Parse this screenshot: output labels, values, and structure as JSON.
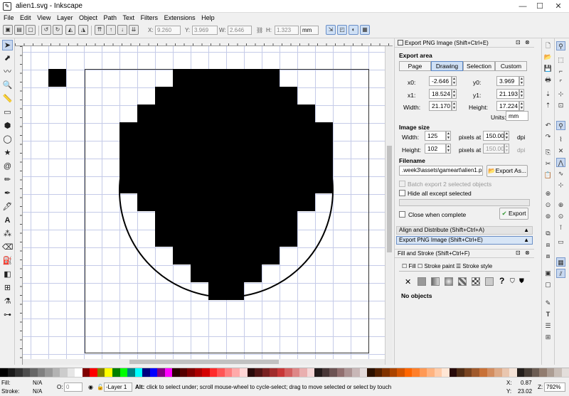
{
  "window": {
    "title": "alien1.svg - Inkscape"
  },
  "menu": [
    "File",
    "Edit",
    "View",
    "Layer",
    "Object",
    "Path",
    "Text",
    "Filters",
    "Extensions",
    "Help"
  ],
  "toolbar": {
    "x_label": "X:",
    "x_value": "9.260",
    "y_label": "Y:",
    "y_value": "3.969",
    "w_label": "W:",
    "w_value": "2.646",
    "h_label": "H:",
    "h_value": "1.323",
    "unit": "mm"
  },
  "export": {
    "panel_title": "Export PNG Image (Shift+Ctrl+E)",
    "area_heading": "Export area",
    "tabs": [
      "Page",
      "Drawing",
      "Selection",
      "Custom"
    ],
    "active_tab": "Drawing",
    "x0_label": "x0:",
    "x0": "-2.646",
    "y0_label": "y0:",
    "y0": "3.969",
    "x1_label": "x1:",
    "x1": "18.524",
    "y1_label": "y1:",
    "y1": "21.193",
    "width_label": "Width:",
    "width": "21.170",
    "height_label": "Height:",
    "height": "17.224",
    "units_label": "Units:",
    "units": "mm",
    "size_heading": "Image size",
    "img_width_label": "Width:",
    "img_width": "125",
    "img_height_label": "Height:",
    "img_height": "102",
    "pixels_at": "pixels at",
    "dpi_x": "150.00",
    "dpi_y": "150.00",
    "dpi": "dpi",
    "filename_heading": "Filename",
    "filename": ".week3\\assets\\gameart\\alien1.png",
    "export_as": "Export As...",
    "batch": "Batch export 2 selected objects",
    "hide": "Hide all except selected",
    "close_when_complete": "Close when complete",
    "export_button": "Export"
  },
  "panels": {
    "align": "Align and Distribute (Shift+Ctrl+A)",
    "export_png": "Export PNG Image (Shift+Ctrl+E)",
    "fill_stroke": "Fill and Stroke (Shift+Ctrl+F)"
  },
  "fill_stroke": {
    "tabs": [
      "Fill",
      "Stroke paint",
      "Stroke style"
    ],
    "no_objects": "No objects"
  },
  "palette_colors": [
    "#000000",
    "#1a1a1a",
    "#333333",
    "#4d4d4d",
    "#666666",
    "#808080",
    "#999999",
    "#b3b3b3",
    "#cccccc",
    "#e6e6e6",
    "#ffffff",
    "#800000",
    "#ff0000",
    "#808000",
    "#ffff00",
    "#008000",
    "#00ff00",
    "#008080",
    "#00ffff",
    "#000080",
    "#0000ff",
    "#800080",
    "#ff00ff",
    "#2b0000",
    "#550000",
    "#800000",
    "#aa0000",
    "#d40000",
    "#ff2a2a",
    "#ff5555",
    "#ff8080",
    "#ffaaaa",
    "#ffd5d5",
    "#280b0b",
    "#501616",
    "#782121",
    "#a02c2c",
    "#c83737",
    "#d35f5f",
    "#de8787",
    "#e9afaf",
    "#f4d7d7",
    "#241c1c",
    "#483737",
    "#6c5353",
    "#916f6f",
    "#ac9393",
    "#c8b7b7",
    "#e3dbdb",
    "#2b1100",
    "#552200",
    "#803300",
    "#aa4400",
    "#d45500",
    "#ff6600",
    "#ff7f2a",
    "#ff9955",
    "#ffb380",
    "#ffccaa",
    "#ffe6d5",
    "#280b0b",
    "#502d16",
    "#784421",
    "#a05a2c",
    "#c87137",
    "#d38d5f",
    "#deaa87",
    "#e9c6af",
    "#f4e3d7",
    "#241f1c",
    "#483e37",
    "#6c5d53",
    "#917c6f",
    "#ac9d93",
    "#c8beb7",
    "#e3dedb"
  ],
  "status": {
    "fill_label": "Fill:",
    "fill_value": "N/A",
    "stroke_label": "Stroke:",
    "stroke_value": "N/A",
    "opacity_label": "O:",
    "opacity_value": "0",
    "layer": "-Layer 1",
    "message_bold": "Alt:",
    "message": " click to select under; scroll mouse-wheel to cycle-select; drag to move selected or select by touch",
    "x_label": "X:",
    "x_value": "0.87",
    "y_label": "Y:",
    "y_value": "23.02",
    "z_label": "Z:",
    "zoom": "792%"
  }
}
